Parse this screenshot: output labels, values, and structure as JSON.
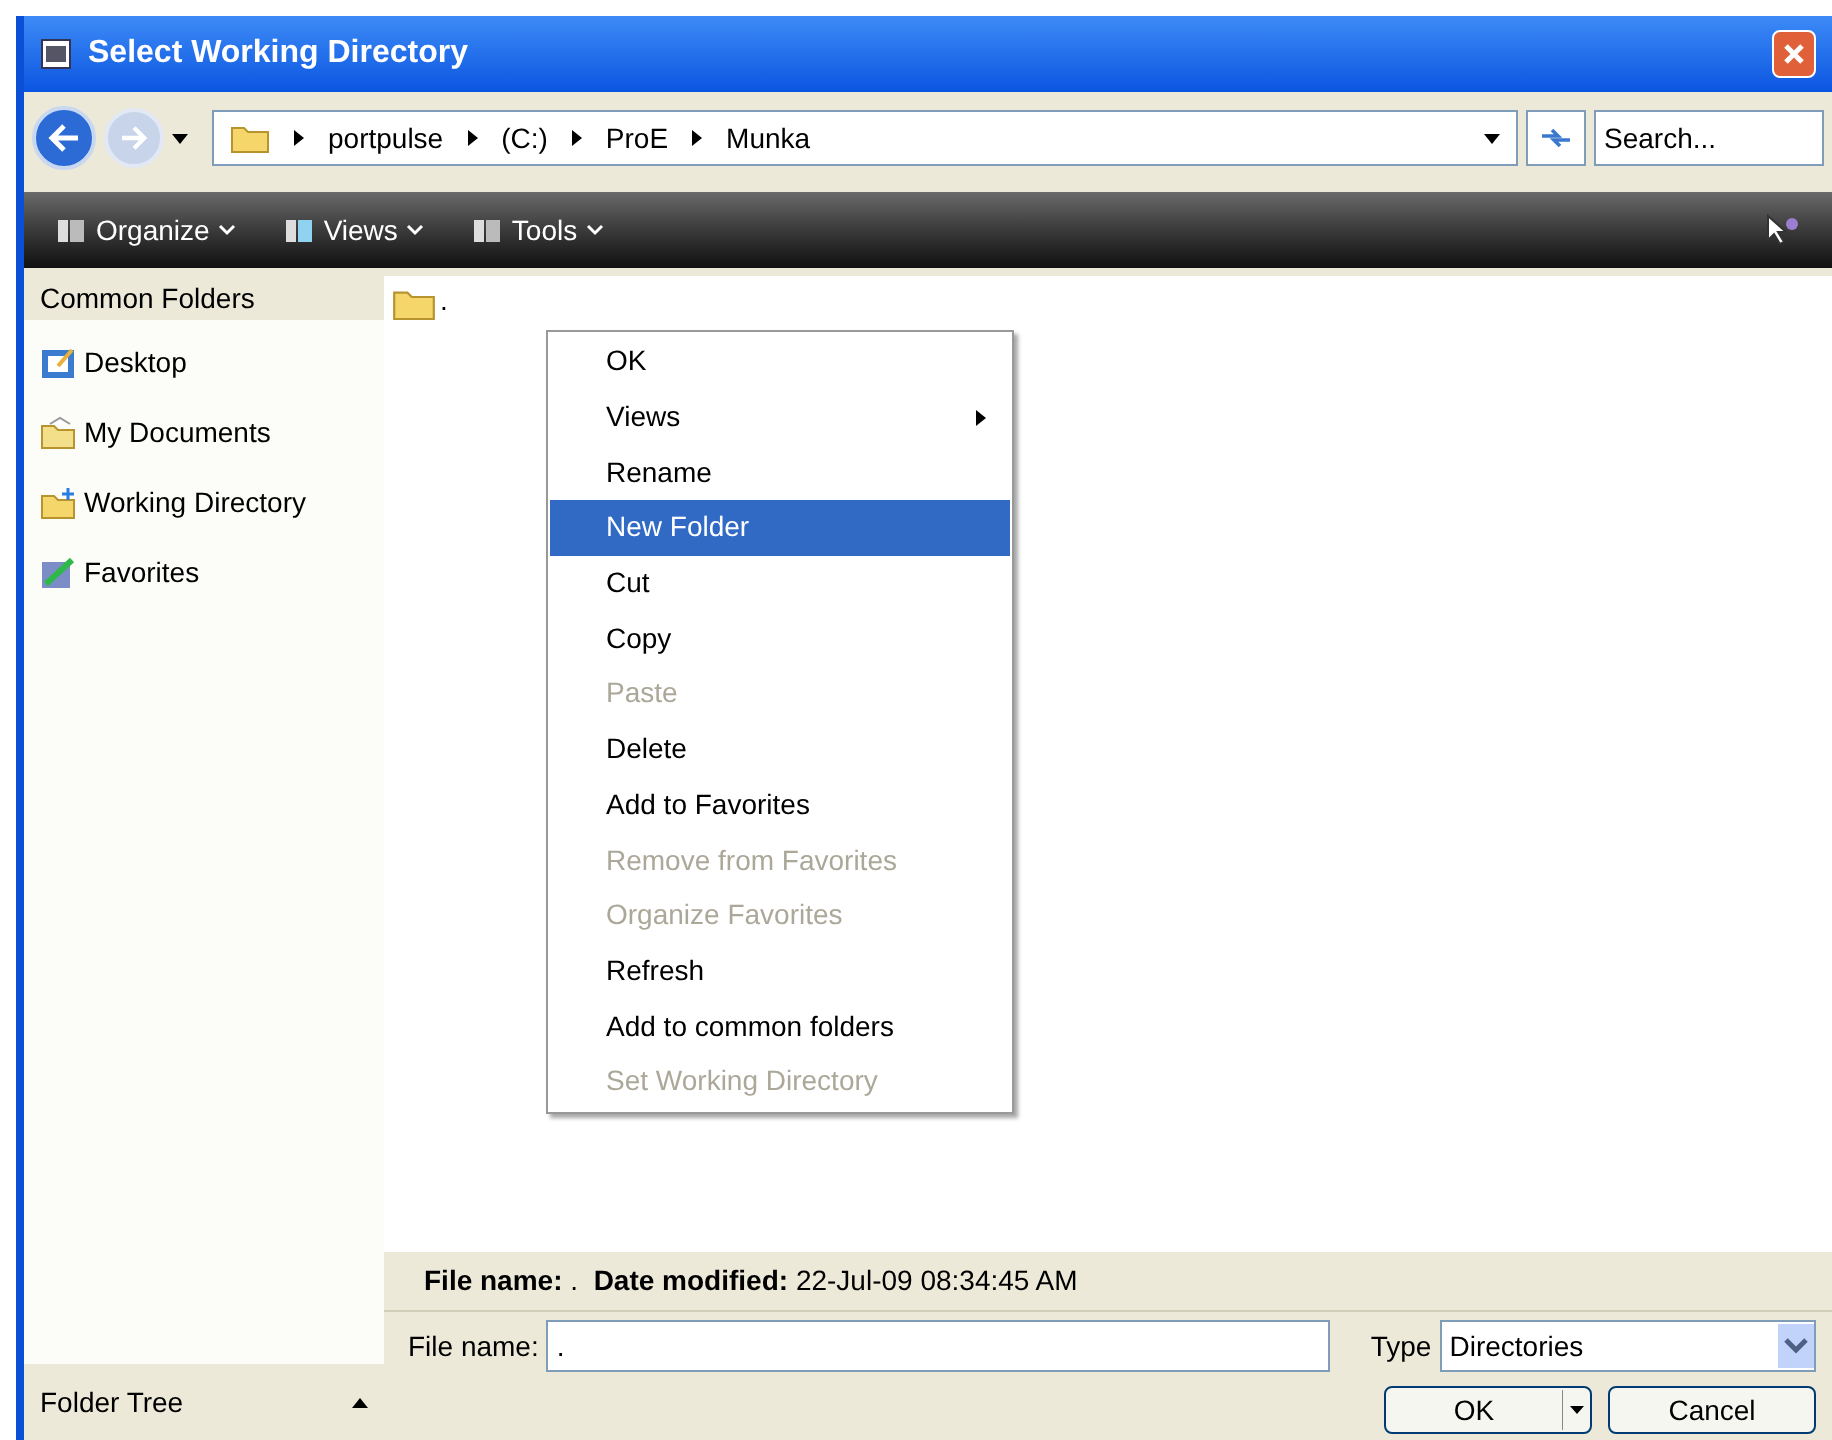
{
  "window": {
    "title": "Select Working Directory"
  },
  "address": {
    "crumbs": [
      "portpulse",
      "(C:)",
      "ProE",
      "Munka"
    ]
  },
  "search": {
    "placeholder": "Search..."
  },
  "toolbar": [
    "Organize",
    "Views",
    "Tools"
  ],
  "sidebar": {
    "heading": "Common Folders",
    "items": [
      {
        "label": "Desktop",
        "kind": "desktop"
      },
      {
        "label": "My Documents",
        "kind": "documents"
      },
      {
        "label": "Working Directory",
        "kind": "working"
      },
      {
        "label": "Favorites",
        "kind": "favorites"
      }
    ],
    "footer": "Folder Tree"
  },
  "files": [
    {
      "name": "."
    }
  ],
  "context_menu": [
    {
      "label": "OK",
      "disabled": false,
      "selected": false
    },
    {
      "label": "Views",
      "disabled": false,
      "selected": false,
      "submenu": true
    },
    {
      "label": "Rename",
      "disabled": false,
      "selected": false
    },
    {
      "label": "New Folder",
      "disabled": false,
      "selected": true
    },
    {
      "label": "Cut",
      "disabled": false,
      "selected": false
    },
    {
      "label": "Copy",
      "disabled": false,
      "selected": false
    },
    {
      "label": "Paste",
      "disabled": true,
      "selected": false
    },
    {
      "label": "Delete",
      "disabled": false,
      "selected": false
    },
    {
      "label": "Add to Favorites",
      "disabled": false,
      "selected": false
    },
    {
      "label": "Remove from Favorites",
      "disabled": true,
      "selected": false
    },
    {
      "label": "Organize Favorites",
      "disabled": true,
      "selected": false
    },
    {
      "label": "Refresh",
      "disabled": false,
      "selected": false
    },
    {
      "label": "Add to common folders",
      "disabled": false,
      "selected": false
    },
    {
      "label": "Set Working Directory",
      "disabled": true,
      "selected": false
    }
  ],
  "details": {
    "name_label": "File name:",
    "name_value": ".",
    "date_label": "Date modified:",
    "date_value": "22-Jul-09 08:34:45 AM"
  },
  "form": {
    "name_label": "File name:",
    "name_value": ".",
    "type_label": "Type",
    "type_value": "Directories"
  },
  "buttons": {
    "ok": "OK",
    "cancel": "Cancel"
  }
}
